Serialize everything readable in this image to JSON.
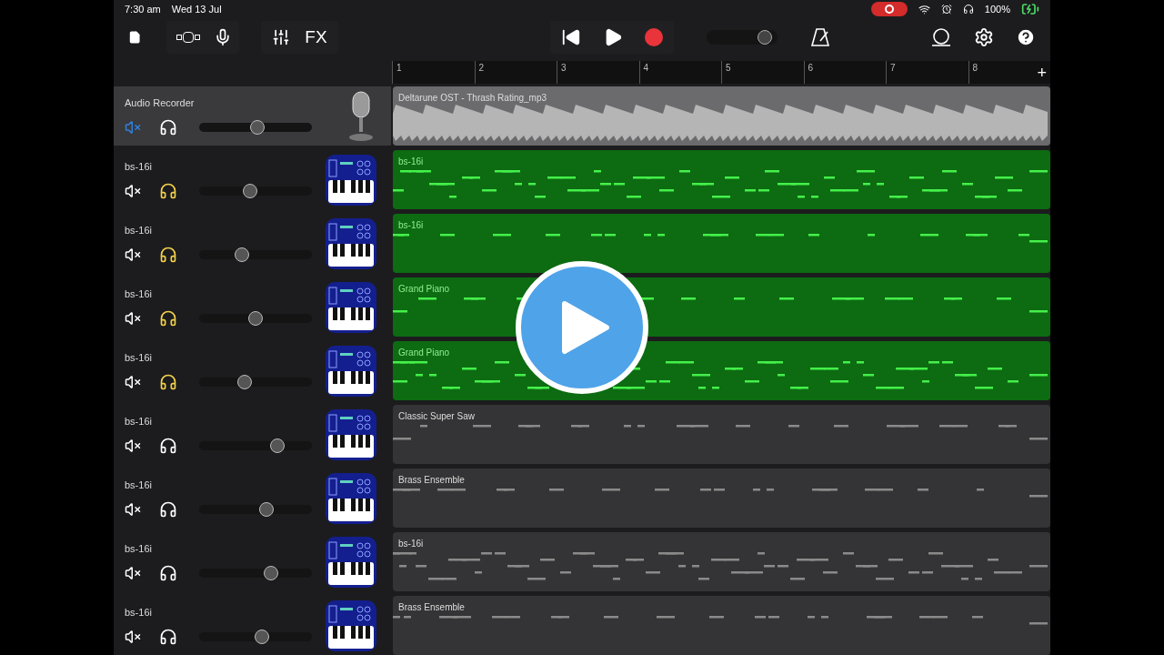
{
  "status_bar": {
    "time": "7:30 am",
    "date": "Wed 13 Jul",
    "battery": "100%",
    "recording": true
  },
  "toolbar": {
    "fx_label": "FX",
    "master_volume": {
      "level": 0.82
    }
  },
  "ruler": {
    "bars": [
      "1",
      "2",
      "3",
      "4",
      "5",
      "6",
      "7",
      "8"
    ],
    "add": "+"
  },
  "tracks": [
    {
      "name": "Audio Recorder",
      "kind": "audio",
      "selected": true,
      "muted": true,
      "solo": false,
      "level": 0.52,
      "region": {
        "label": "Deltarune OST - Thrash Rating_mp3",
        "selected": false
      }
    },
    {
      "name": "bs-16i",
      "kind": "synth",
      "selected": false,
      "muted": false,
      "solo": true,
      "level": 0.45,
      "region": {
        "label": "bs-16i",
        "selected": true
      }
    },
    {
      "name": "bs-16i",
      "kind": "synth",
      "selected": false,
      "muted": false,
      "solo": true,
      "level": 0.38,
      "region": {
        "label": "bs-16i",
        "selected": true
      }
    },
    {
      "name": "bs-16i",
      "kind": "synth",
      "selected": false,
      "muted": false,
      "solo": true,
      "level": 0.5,
      "region": {
        "label": "Grand Piano",
        "selected": true
      }
    },
    {
      "name": "bs-16i",
      "kind": "synth",
      "selected": false,
      "muted": false,
      "solo": true,
      "level": 0.4,
      "region": {
        "label": "Grand Piano",
        "selected": true
      }
    },
    {
      "name": "bs-16i",
      "kind": "synth",
      "selected": false,
      "muted": false,
      "solo": false,
      "level": 0.69,
      "region": {
        "label": "Classic Super Saw",
        "selected": false
      }
    },
    {
      "name": "bs-16i",
      "kind": "synth",
      "selected": false,
      "muted": false,
      "solo": false,
      "level": 0.6,
      "region": {
        "label": "Brass Ensemble",
        "selected": false
      }
    },
    {
      "name": "bs-16i",
      "kind": "synth",
      "selected": false,
      "muted": false,
      "solo": false,
      "level": 0.64,
      "region": {
        "label": "bs-16i",
        "selected": false
      }
    },
    {
      "name": "bs-16i",
      "kind": "synth",
      "selected": false,
      "muted": false,
      "solo": false,
      "level": 0.56,
      "region": {
        "label": "Brass Ensemble",
        "selected": false
      }
    }
  ]
}
